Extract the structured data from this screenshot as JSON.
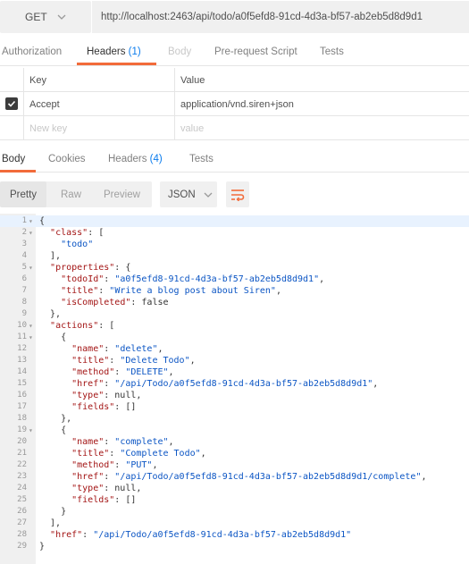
{
  "request": {
    "method": "GET",
    "url": "http://localhost:2463/api/todo/a0f5efd8-91cd-4d3a-bf57-ab2eb5d8d9d1"
  },
  "request_tabs": [
    {
      "label": "Authorization",
      "count": ""
    },
    {
      "label": "Headers",
      "count": "(1)"
    },
    {
      "label": "Body",
      "count": ""
    },
    {
      "label": "Pre-request Script",
      "count": ""
    },
    {
      "label": "Tests",
      "count": ""
    }
  ],
  "headers_table": {
    "col_key": "Key",
    "col_value": "Value",
    "rows": [
      {
        "key": "Accept",
        "value": "application/vnd.siren+json",
        "checked": true
      }
    ],
    "new_key_placeholder": "New key",
    "new_value_placeholder": "value"
  },
  "response_tabs": [
    {
      "label": "Body",
      "count": ""
    },
    {
      "label": "Cookies",
      "count": ""
    },
    {
      "label": "Headers",
      "count": "(4)"
    },
    {
      "label": "Tests",
      "count": ""
    }
  ],
  "view_modes": [
    "Pretty",
    "Raw",
    "Preview"
  ],
  "format": "JSON",
  "colors": {
    "accent": "#f26b3a",
    "link": "#097bed",
    "string": "#0b55c4",
    "key": "#a31515"
  },
  "code_lines": [
    "{",
    "  \"class\": [",
    "    \"todo\"",
    "  ],",
    "  \"properties\": {",
    "    \"todoId\": \"a0f5efd8-91cd-4d3a-bf57-ab2eb5d8d9d1\",",
    "    \"title\": \"Write a blog post about Siren\",",
    "    \"isCompleted\": false",
    "  },",
    "  \"actions\": [",
    "    {",
    "      \"name\": \"delete\",",
    "      \"title\": \"Delete Todo\",",
    "      \"method\": \"DELETE\",",
    "      \"href\": \"/api/Todo/a0f5efd8-91cd-4d3a-bf57-ab2eb5d8d9d1\",",
    "      \"type\": null,",
    "      \"fields\": []",
    "    },",
    "    {",
    "      \"name\": \"complete\",",
    "      \"title\": \"Complete Todo\",",
    "      \"method\": \"PUT\",",
    "      \"href\": \"/api/Todo/a0f5efd8-91cd-4d3a-bf57-ab2eb5d8d9d1/complete\",",
    "      \"type\": null,",
    "      \"fields\": []",
    "    }",
    "  ],",
    "  \"href\": \"/api/Todo/a0f5efd8-91cd-4d3a-bf57-ab2eb5d8d9d1\"",
    "}"
  ],
  "foldable_lines": [
    1,
    2,
    5,
    10,
    11,
    19
  ]
}
